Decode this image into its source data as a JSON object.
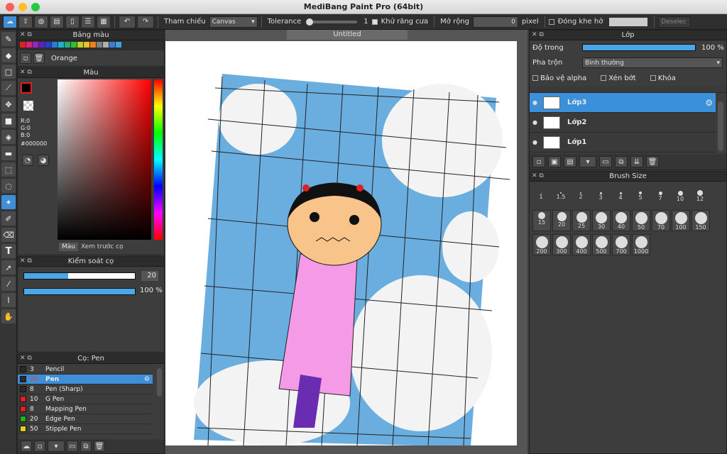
{
  "window": {
    "title": "MediBang Paint Pro (64bit)"
  },
  "toolbar": {
    "reference_label": "Tham chiếu",
    "reference_value": "Canvas",
    "tolerance_label": "Tolerance",
    "tolerance_value": "1",
    "antialias_label": "Khử răng cưa",
    "expand_label": "Mở rộng",
    "expand_value": "0",
    "pixel_label": "pixel",
    "gap_label": "Đóng khe hở",
    "deselect_label": "Deselec"
  },
  "palette_panel": {
    "title": "Bảng màu",
    "color_name": "Orange",
    "swatches": [
      "#e02020",
      "#e02080",
      "#a020c0",
      "#6020c0",
      "#2040d0",
      "#2080e0",
      "#20b0d0",
      "#20b080",
      "#30c030",
      "#c0d020",
      "#f0c020",
      "#f08020",
      "#808080",
      "#b0b0b0",
      "#3a7fd0",
      "#40a0e0"
    ]
  },
  "color_panel": {
    "title": "Màu",
    "r": "R:0",
    "g": "G:0",
    "b": "B:0",
    "hex": "#000000",
    "tab_color": "Màu",
    "tab_preview": "Xem trước cọ"
  },
  "brush_control": {
    "title": "Kiểm soát cọ",
    "size": "20",
    "opacity": "100 %",
    "size_fraction": 0.4,
    "opacity_fraction": 1.0
  },
  "brush_panel": {
    "title": "Cọ: Pen",
    "brushes": [
      {
        "size": "3",
        "name": "Pencil",
        "color": "#2a2a2a"
      },
      {
        "size": "20",
        "name": "Pen",
        "color": "#2a2a2a"
      },
      {
        "size": "8",
        "name": "Pen (Sharp)",
        "color": "#2a2a2a"
      },
      {
        "size": "10",
        "name": "G Pen",
        "color": "#e02020"
      },
      {
        "size": "8",
        "name": "Mapping Pen",
        "color": "#e02020"
      },
      {
        "size": "20",
        "name": "Edge Pen",
        "color": "#20b020"
      },
      {
        "size": "50",
        "name": "Stipple Pen",
        "color": "#e0d020"
      }
    ]
  },
  "document": {
    "tab": "Untitled"
  },
  "layer_panel": {
    "title": "Lớp",
    "opacity_label": "Độ trong",
    "opacity_value": "100 %",
    "blend_label": "Pha trộn",
    "blend_value": "Bình thường",
    "protect_alpha": "Bảo vệ alpha",
    "clip": "Xén bớt",
    "lock": "Khóa",
    "layers": [
      {
        "name": "Lớp3",
        "selected": true
      },
      {
        "name": "Lớp2",
        "selected": false
      },
      {
        "name": "Lớp1",
        "selected": false
      }
    ]
  },
  "brush_size_panel": {
    "title": "Brush Size",
    "sizes_small": [
      "1",
      "1.5",
      "2",
      "3",
      "4",
      "5",
      "7",
      "10",
      "12"
    ],
    "sizes_medium": [
      "15",
      "20",
      "25",
      "30",
      "40",
      "50",
      "70",
      "100",
      "150"
    ],
    "sizes_large": [
      "200",
      "300",
      "400",
      "500",
      "700",
      "1000"
    ]
  }
}
